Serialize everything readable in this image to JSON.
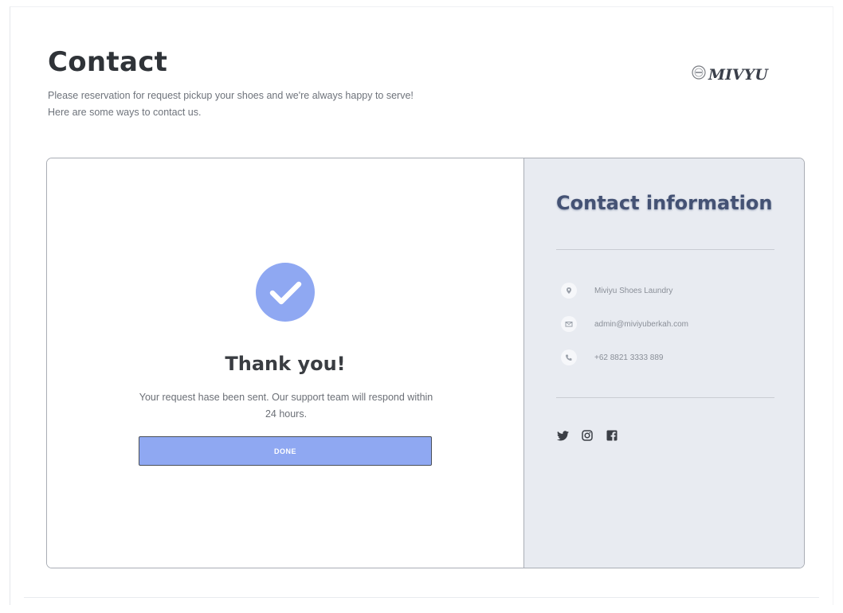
{
  "header": {
    "title": "Contact",
    "subtitle_line1": "Please reservation for request pickup your shoes and we're always happy to serve!",
    "subtitle_line2": "Here are some ways to contact us."
  },
  "brand": {
    "logo_text": "MIVYU",
    "logo_icon": "brand-badge-icon"
  },
  "success": {
    "icon": "check-circle-icon",
    "title": "Thank you!",
    "message": "Your request hase been sent. Our support team will respond within 24 hours.",
    "button_label": "DONE"
  },
  "contact_info": {
    "title": "Contact information",
    "items": [
      {
        "icon": "location-pin-icon",
        "text": "Miviyu Shoes Laundry"
      },
      {
        "icon": "email-icon",
        "text": "admin@miviyuberkah.com"
      },
      {
        "icon": "phone-icon",
        "text": "+62 8821 3333 889"
      }
    ],
    "social": [
      {
        "icon": "twitter-icon"
      },
      {
        "icon": "instagram-icon"
      },
      {
        "icon": "facebook-icon"
      }
    ]
  },
  "colors": {
    "accent": "#8fa8f2",
    "panel_bg": "#e8ebf1",
    "heading_dark": "#2f3338",
    "info_title": "#445274"
  }
}
